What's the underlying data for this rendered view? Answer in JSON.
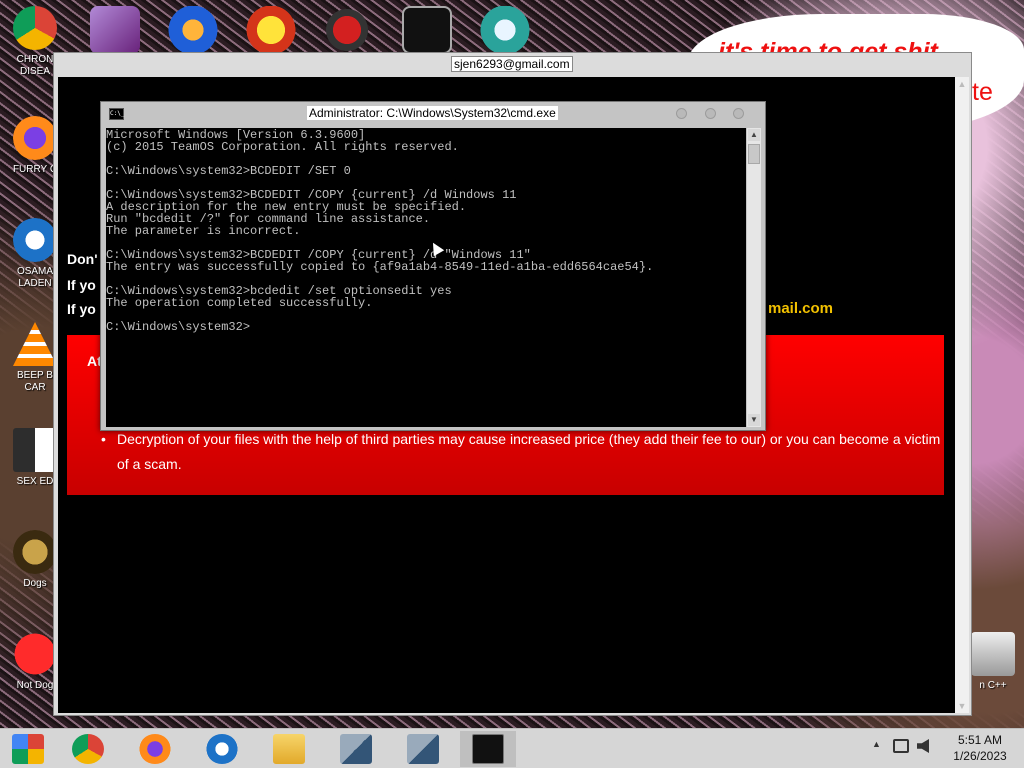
{
  "desktop": {
    "icons": [
      {
        "label": "CHRON\nDISEA",
        "icon": "chrome-icon"
      },
      {
        "label": "FURRY C",
        "icon": "firefox-icon"
      },
      {
        "label": "OSAMA\nLADEN",
        "icon": "obama-icon"
      },
      {
        "label": "BEEP B\nCAR",
        "icon": "vlc-icon"
      },
      {
        "label": "SEX ED",
        "icon": "hx-icon"
      },
      {
        "label": "Dogs",
        "icon": "dogs-icon"
      },
      {
        "label": "Not Dog",
        "icon": "devcpp-icon"
      }
    ],
    "right_icon_label": "n C++",
    "speech_text": "it's time to get shit",
    "speech_text_2": "te"
  },
  "ransom_window": {
    "title": "sjen6293@gmail.com",
    "line1": "Don'",
    "line2": "If yo",
    "line3": "If yo",
    "email_fragment": "mail.com",
    "red_heading": "At",
    "bullet_text": "Decryption of your files with the help of third parties may cause increased price (they add their fee to our) or you can become a victim of a scam."
  },
  "cmd_window": {
    "title": "Administrator: C:\\Windows\\System32\\cmd.exe",
    "icon_label": "C:\\_",
    "lines": [
      "Microsoft Windows [Version 6.3.9600]",
      "(c) 2015 TeamOS Corporation. All rights reserved.",
      "",
      "C:\\Windows\\system32>BCDEDIT /SET 0",
      "",
      "C:\\Windows\\system32>BCDEDIT /COPY {current} /d Windows 11",
      "A description for the new entry must be specified.",
      "Run \"bcdedit /?\" for command line assistance.",
      "The parameter is incorrect.",
      "",
      "C:\\Windows\\system32>BCDEDIT /COPY {current} /d \"Windows 11\"",
      "The entry was successfully copied to {af9a1ab4-8549-11ed-a1ba-edd6564cae54}.",
      "",
      "C:\\Windows\\system32>bcdedit /set optionsedit yes",
      "The operation completed successfully.",
      "",
      "C:\\Windows\\system32>"
    ]
  },
  "taskbar": {
    "apps": [
      {
        "name": "start-icon"
      },
      {
        "name": "chrome-icon"
      },
      {
        "name": "firefox-icon"
      },
      {
        "name": "obama-icon"
      },
      {
        "name": "file-explorer-icon"
      },
      {
        "name": "network-setup-icon"
      },
      {
        "name": "network-setup-2-icon"
      },
      {
        "name": "cmd-icon"
      }
    ],
    "tray_chevron": "▲",
    "time": "5:51 AM",
    "date": "1/26/2023"
  },
  "colors": {
    "ransom_red": "#ff0000",
    "email_yellow": "#f2c100",
    "console_text": "#c0c0c0"
  }
}
